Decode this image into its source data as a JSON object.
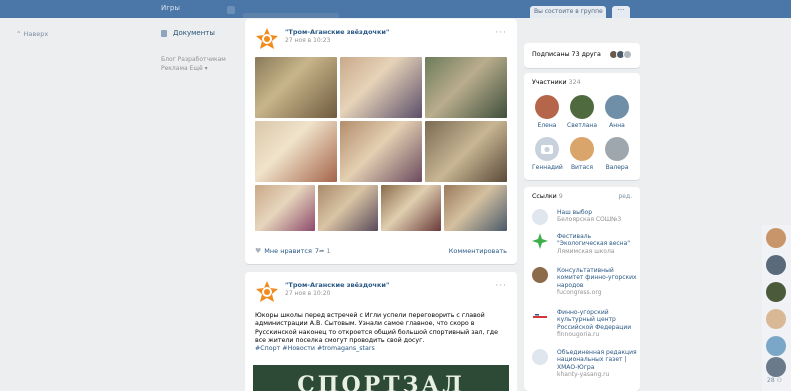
{
  "topbar": {
    "menu_fragment": "Игры",
    "joined_button": "Вы состоите в группе",
    "more_button": "···"
  },
  "left_nav": {
    "back": "Наверх",
    "documents": "Документы",
    "footer_line1": "Блог  Разработчикам",
    "footer_line2": "Реклама  Ещё ▾"
  },
  "post1": {
    "author": "\"Тром-Аганские звёздочки\"",
    "date": "27 ноя в 10:23",
    "menu": "···",
    "likes_label": "Мне нравится",
    "likes_count": "7",
    "shares_count": "1",
    "comment_label": "Комментировать"
  },
  "post2": {
    "author": "\"Тром-Аганские звёздочки\"",
    "date": "27 ноя в 10:20",
    "menu": "···",
    "text": "Юкоры школы перед встречей с Игли успели переговорить с главой администрации А.В. Сытовым. Узнали самое главное, что скоро в Русскинской наконец то откроется общий большой спортивный зал, где все жители поселка смогут проводить свой досуг.",
    "tags": "#Спорт #Новости #tromagans_stars",
    "image_text": "СПОРТЗАЛ"
  },
  "right": {
    "friends": "Подписаны 73 друга",
    "members_title": "Участники",
    "members_count": "324",
    "members": [
      {
        "name": "Елена",
        "color": "#b5654a"
      },
      {
        "name": "Светлана",
        "color": "#4f6a3f"
      },
      {
        "name": "Анна",
        "color": "#6f8fa8"
      },
      {
        "name": "Геннадий",
        "color": "#c8d2dd"
      },
      {
        "name": "Витася",
        "color": "#d9a56a"
      },
      {
        "name": "Валера",
        "color": "#9ea7ad"
      }
    ],
    "links_title": "Ссылки",
    "links_count": "9",
    "links_edit": "ред.",
    "links": [
      {
        "title": "Наш выбор",
        "sub": "Белоярская СОШ№3",
        "color": "#dfe6ee"
      },
      {
        "title": "Фестиваль \"Экологическая весна\"",
        "sub": "Лямимская школа",
        "color": "#3fae4a"
      },
      {
        "title": "Консультативный комитет финно-угорских народов",
        "sub": "fucongress.org",
        "color": "#8b6b4a"
      },
      {
        "title": "Финно-угорский культурный центр Российской Федерации",
        "sub": "finnougoria.ru",
        "color": "#d2363a"
      },
      {
        "title": "Объединенная редакция национальных газет | ХМАО-Югра",
        "sub": "khanty-yasang.ru",
        "color": "#dfe6ee"
      }
    ]
  },
  "rail": {
    "count": "28 ⚇"
  },
  "colors": {
    "header": "#4a76a8",
    "link": "#2a5885",
    "brand_orange": "#f28b1d"
  }
}
